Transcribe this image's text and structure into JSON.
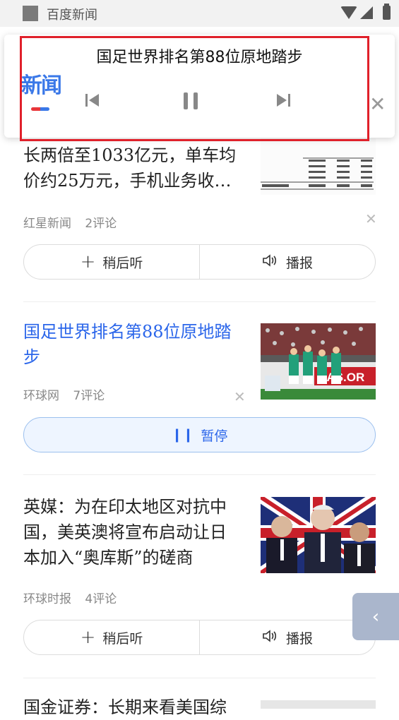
{
  "status_bar": {
    "app_name": "百度新闻"
  },
  "player": {
    "title": "国足世界排名第88位原地踏步",
    "logo": "新闻"
  },
  "articles": [
    {
      "headline_partial_line1": "长两倍至1033亿元，单车均",
      "headline_partial_line2": "价约25万元，手机业务收…",
      "source": "红星新闻",
      "comments": "2评论",
      "actions": {
        "later": "稍后听",
        "broadcast": "播报"
      }
    },
    {
      "headline_line1": "国足世界排名第88位原地踏",
      "headline_line2": "步",
      "source": "环球网",
      "comments": "7评论",
      "pause_label": "暂停",
      "thumb_text": "FAS.OR"
    },
    {
      "headline_line1": "英媒：为在印太地区对抗中",
      "headline_line2": "国，美英澳将宣布启动让日",
      "headline_line3": "本加入“奥库斯”的磋商",
      "source": "环球时报",
      "comments": "4评论",
      "actions": {
        "later": "稍后听",
        "broadcast": "播报"
      }
    },
    {
      "headline_partial": "国金证券：长期来看美国综"
    }
  ],
  "colors": {
    "accent": "#2b66ea",
    "highlight": "#e0202a"
  }
}
